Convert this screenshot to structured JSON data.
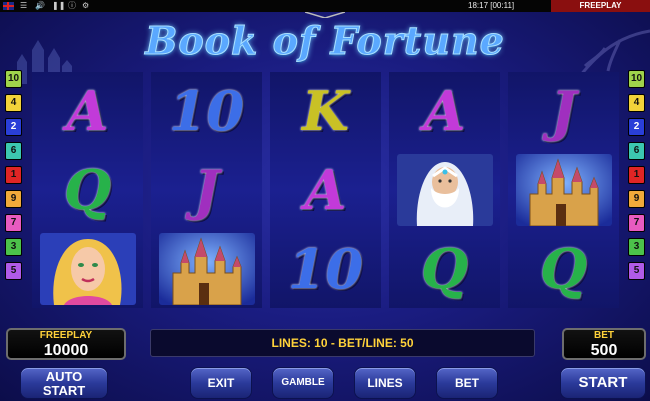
{
  "topbar": {
    "time": "18:17 [00:11]",
    "mode": "FREEPLAY"
  },
  "title": "Book of Fortune",
  "reels": [
    [
      {
        "type": "letter",
        "text": "A",
        "color": "#c23ad9"
      },
      {
        "type": "letter",
        "text": "Q",
        "color": "#27b24a"
      },
      {
        "type": "picture",
        "icon": "princess"
      }
    ],
    [
      {
        "type": "letter",
        "text": "10",
        "color": "#3c6ee8"
      },
      {
        "type": "letter",
        "text": "J",
        "color": "#a02fbf"
      },
      {
        "type": "picture",
        "icon": "castle"
      }
    ],
    [
      {
        "type": "letter",
        "text": "K",
        "color": "#c9c125"
      },
      {
        "type": "letter",
        "text": "A",
        "color": "#c23ad9"
      },
      {
        "type": "letter",
        "text": "10",
        "color": "#3c6ee8"
      }
    ],
    [
      {
        "type": "letter",
        "text": "A",
        "color": "#c23ad9"
      },
      {
        "type": "picture",
        "icon": "wizard"
      },
      {
        "type": "letter",
        "text": "Q",
        "color": "#27b24a"
      }
    ],
    [
      {
        "type": "letter",
        "text": "J",
        "color": "#a02fbf"
      },
      {
        "type": "picture",
        "icon": "castle"
      },
      {
        "type": "letter",
        "text": "Q",
        "color": "#27b24a"
      }
    ]
  ],
  "line_markers_left": [
    {
      "n": "10",
      "color": "#9fd34b"
    },
    {
      "n": "4",
      "color": "#f1d23a"
    },
    {
      "n": "2",
      "color": "#2a3fd8"
    },
    {
      "n": "6",
      "color": "#3cc7b0"
    },
    {
      "n": "1",
      "color": "#e02525"
    },
    {
      "n": "9",
      "color": "#f1a93a"
    },
    {
      "n": "7",
      "color": "#e85bc0"
    },
    {
      "n": "3",
      "color": "#4cc24a"
    },
    {
      "n": "5",
      "color": "#b05be8"
    }
  ],
  "line_markers_right": [
    {
      "n": "10",
      "color": "#9fd34b"
    },
    {
      "n": "4",
      "color": "#f1d23a"
    },
    {
      "n": "2",
      "color": "#2a3fd8"
    },
    {
      "n": "6",
      "color": "#3cc7b0"
    },
    {
      "n": "1",
      "color": "#e02525"
    },
    {
      "n": "9",
      "color": "#f1a93a"
    },
    {
      "n": "7",
      "color": "#e85bc0"
    },
    {
      "n": "3",
      "color": "#4cc24a"
    },
    {
      "n": "5",
      "color": "#b05be8"
    }
  ],
  "credit": {
    "label": "FREEPLAY",
    "value": "10000"
  },
  "bet": {
    "label": "BET",
    "value": "500"
  },
  "lines_info": "LINES: 10  -  BET/LINE: 50",
  "buttons": {
    "auto_start_1": "AUTO",
    "auto_start_2": "START",
    "exit": "EXIT",
    "gamble": "GAMBLE",
    "lines": "LINES",
    "bet": "BET",
    "start": "START"
  }
}
